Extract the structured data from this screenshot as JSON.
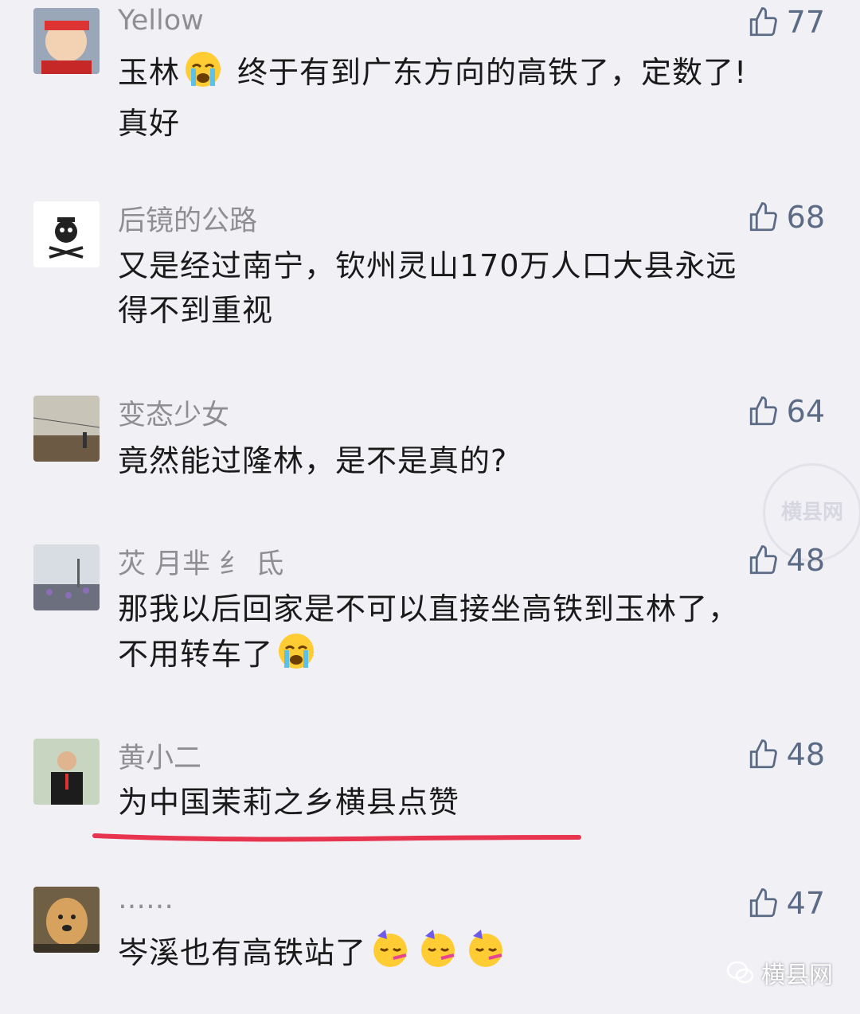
{
  "comments": [
    {
      "user": "Yellow",
      "likes": "77",
      "text_line1": "玉林",
      "text_line1b": "终于有到广东方向的高铁了，定数了!",
      "text_line2": "真好",
      "emoji": "loudly-crying-face-emoji"
    },
    {
      "user": "后镜的公路",
      "likes": "68",
      "text_line1": "又是经过南宁，钦州灵山170万人口大县永远",
      "text_line2": "得不到重视"
    },
    {
      "user": "变态少女",
      "likes": "64",
      "text_line1": "竟然能过隆林，是不是真的?"
    },
    {
      "user": "苂 月芈 纟 氐",
      "likes": "48",
      "text_line1": "那我以后回家是不可以直接坐高铁到玉林了，",
      "text_line2": "不用转车了",
      "emoji": "loudly-crying-face-emoji"
    },
    {
      "user": "黄小二",
      "likes": "48",
      "text_line1": "为中国茉莉之乡横县点赞"
    },
    {
      "user": "……",
      "likes": "47",
      "text_line1": "岑溪也有高铁站了",
      "emoji": "partying-face-emoji"
    }
  ],
  "icons": {
    "like": "thumbs-up-icon",
    "brand": "wechat-icon"
  },
  "watermark": {
    "text": "横县网"
  },
  "brand": {
    "name": "横县网"
  },
  "colors": {
    "background": "#f1f0f5",
    "underline": "#e8354f",
    "like": "#5b6b86"
  }
}
